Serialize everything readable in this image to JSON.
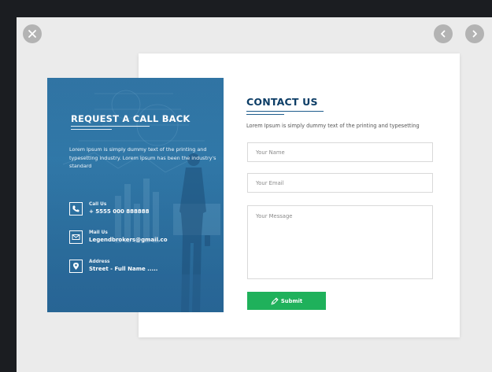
{
  "viewer": {
    "close_icon": "close-icon",
    "prev_icon": "chevron-left-icon",
    "next_icon": "chevron-right-icon"
  },
  "contact": {
    "title": "CONTACT US",
    "subtitle": "Lorem Ipsum is simply dummy text of the printing and typesetting",
    "name_placeholder": "Your Name",
    "email_placeholder": "Your Email",
    "message_placeholder": "Your Message",
    "submit_label": "Submit",
    "submit_icon": "send-icon",
    "colors": {
      "title": "#0c3d66",
      "submit": "#1fb15b"
    }
  },
  "callback": {
    "title": "REQUEST A CALL BACK",
    "text": "Lorem Ipsum is simply dummy text of the printing and typesetting industry. Lorem Ipsum has been the industry's standard",
    "colors": {
      "panel": "#2f78a8"
    },
    "items": [
      {
        "icon": "phone-icon",
        "label": "Call Us",
        "value": "+ 5555 000 888888"
      },
      {
        "icon": "mail-icon",
        "label": "Mail Us",
        "value": "Legendbrokers@gmail.co"
      },
      {
        "icon": "location-icon",
        "label": "Address",
        "value": "Street - Full Name ....."
      }
    ]
  }
}
